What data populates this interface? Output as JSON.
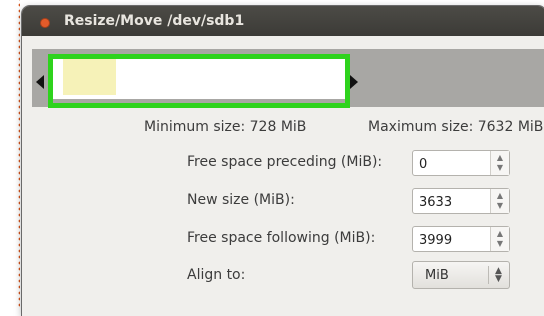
{
  "window": {
    "title": "Resize/Move /dev/sdb1"
  },
  "sizes": {
    "minimum": "Minimum size: 728 MiB",
    "maximum": "Maximum size: 7632 MiB"
  },
  "fields": {
    "preceding": {
      "label": "Free space preceding (MiB):",
      "value": "0"
    },
    "new_size": {
      "label": "New size (MiB):",
      "value": "3633"
    },
    "following": {
      "label": "Free space following (MiB):",
      "value": "3999"
    },
    "align": {
      "label": "Align to:",
      "value": "MiB"
    }
  },
  "colors": {
    "highlight": "#2ed31d",
    "used": "#f6f2b8",
    "titlebar": "#3c3b37"
  }
}
